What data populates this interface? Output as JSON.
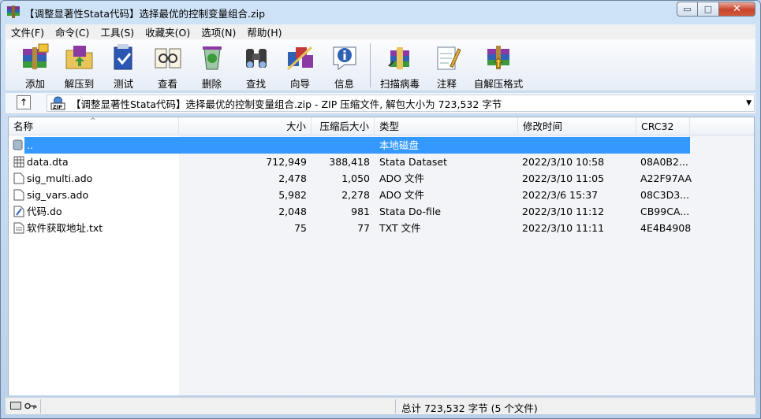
{
  "window": {
    "title": "【调整显著性Stata代码】选择最优的控制变量组合.zip",
    "min_glyph": "▭",
    "max_glyph": "□",
    "close_glyph": "✕"
  },
  "menu": [
    "文件(F)",
    "命令(C)",
    "工具(S)",
    "收藏夹(O)",
    "选项(N)",
    "帮助(H)"
  ],
  "toolbar": {
    "add": "添加",
    "extract": "解压到",
    "test": "测试",
    "view": "查看",
    "delete": "删除",
    "find": "查找",
    "wizard": "向导",
    "info": "信息",
    "virus_scan": "扫描病毒",
    "comment": "注释",
    "sfx": "自解压格式"
  },
  "address": {
    "up_glyph": "↑",
    "text": "【调整显著性Stata代码】选择最优的控制变量组合.zip - ZIP 压缩文件, 解包大小为 723,532 字节",
    "dropdown_glyph": "▼"
  },
  "columns": {
    "name": "名称",
    "size": "大小",
    "packed": "压缩后大小",
    "type": "类型",
    "modified": "修改时间",
    "crc": "CRC32",
    "sort_glyph": "^"
  },
  "parent_row": {
    "name": "..",
    "type": "本地磁盘"
  },
  "files": [
    {
      "name": "data.dta",
      "size": "712,949",
      "packed": "388,418",
      "type": "Stata Dataset",
      "modified": "2022/3/10 10:58",
      "crc": "08A0B2..."
    },
    {
      "name": "sig_multi.ado",
      "size": "2,478",
      "packed": "1,050",
      "type": "ADO 文件",
      "modified": "2022/3/10 11:05",
      "crc": "A22F97AA"
    },
    {
      "name": "sig_vars.ado",
      "size": "5,982",
      "packed": "2,278",
      "type": "ADO 文件",
      "modified": "2022/3/6 15:37",
      "crc": "08C3D3..."
    },
    {
      "name": "代码.do",
      "size": "2,048",
      "packed": "981",
      "type": "Stata Do-file",
      "modified": "2022/3/10 11:12",
      "crc": "CB99CA..."
    },
    {
      "name": "软件获取地址.txt",
      "size": "75",
      "packed": "77",
      "type": "TXT 文件",
      "modified": "2022/3/10 11:11",
      "crc": "4E4B4908"
    }
  ],
  "status": {
    "summary": "总计 723,532 字节 (5 个文件)"
  },
  "colors": {
    "selection": "#3399ff",
    "window_frame": "#b9d1ea"
  }
}
